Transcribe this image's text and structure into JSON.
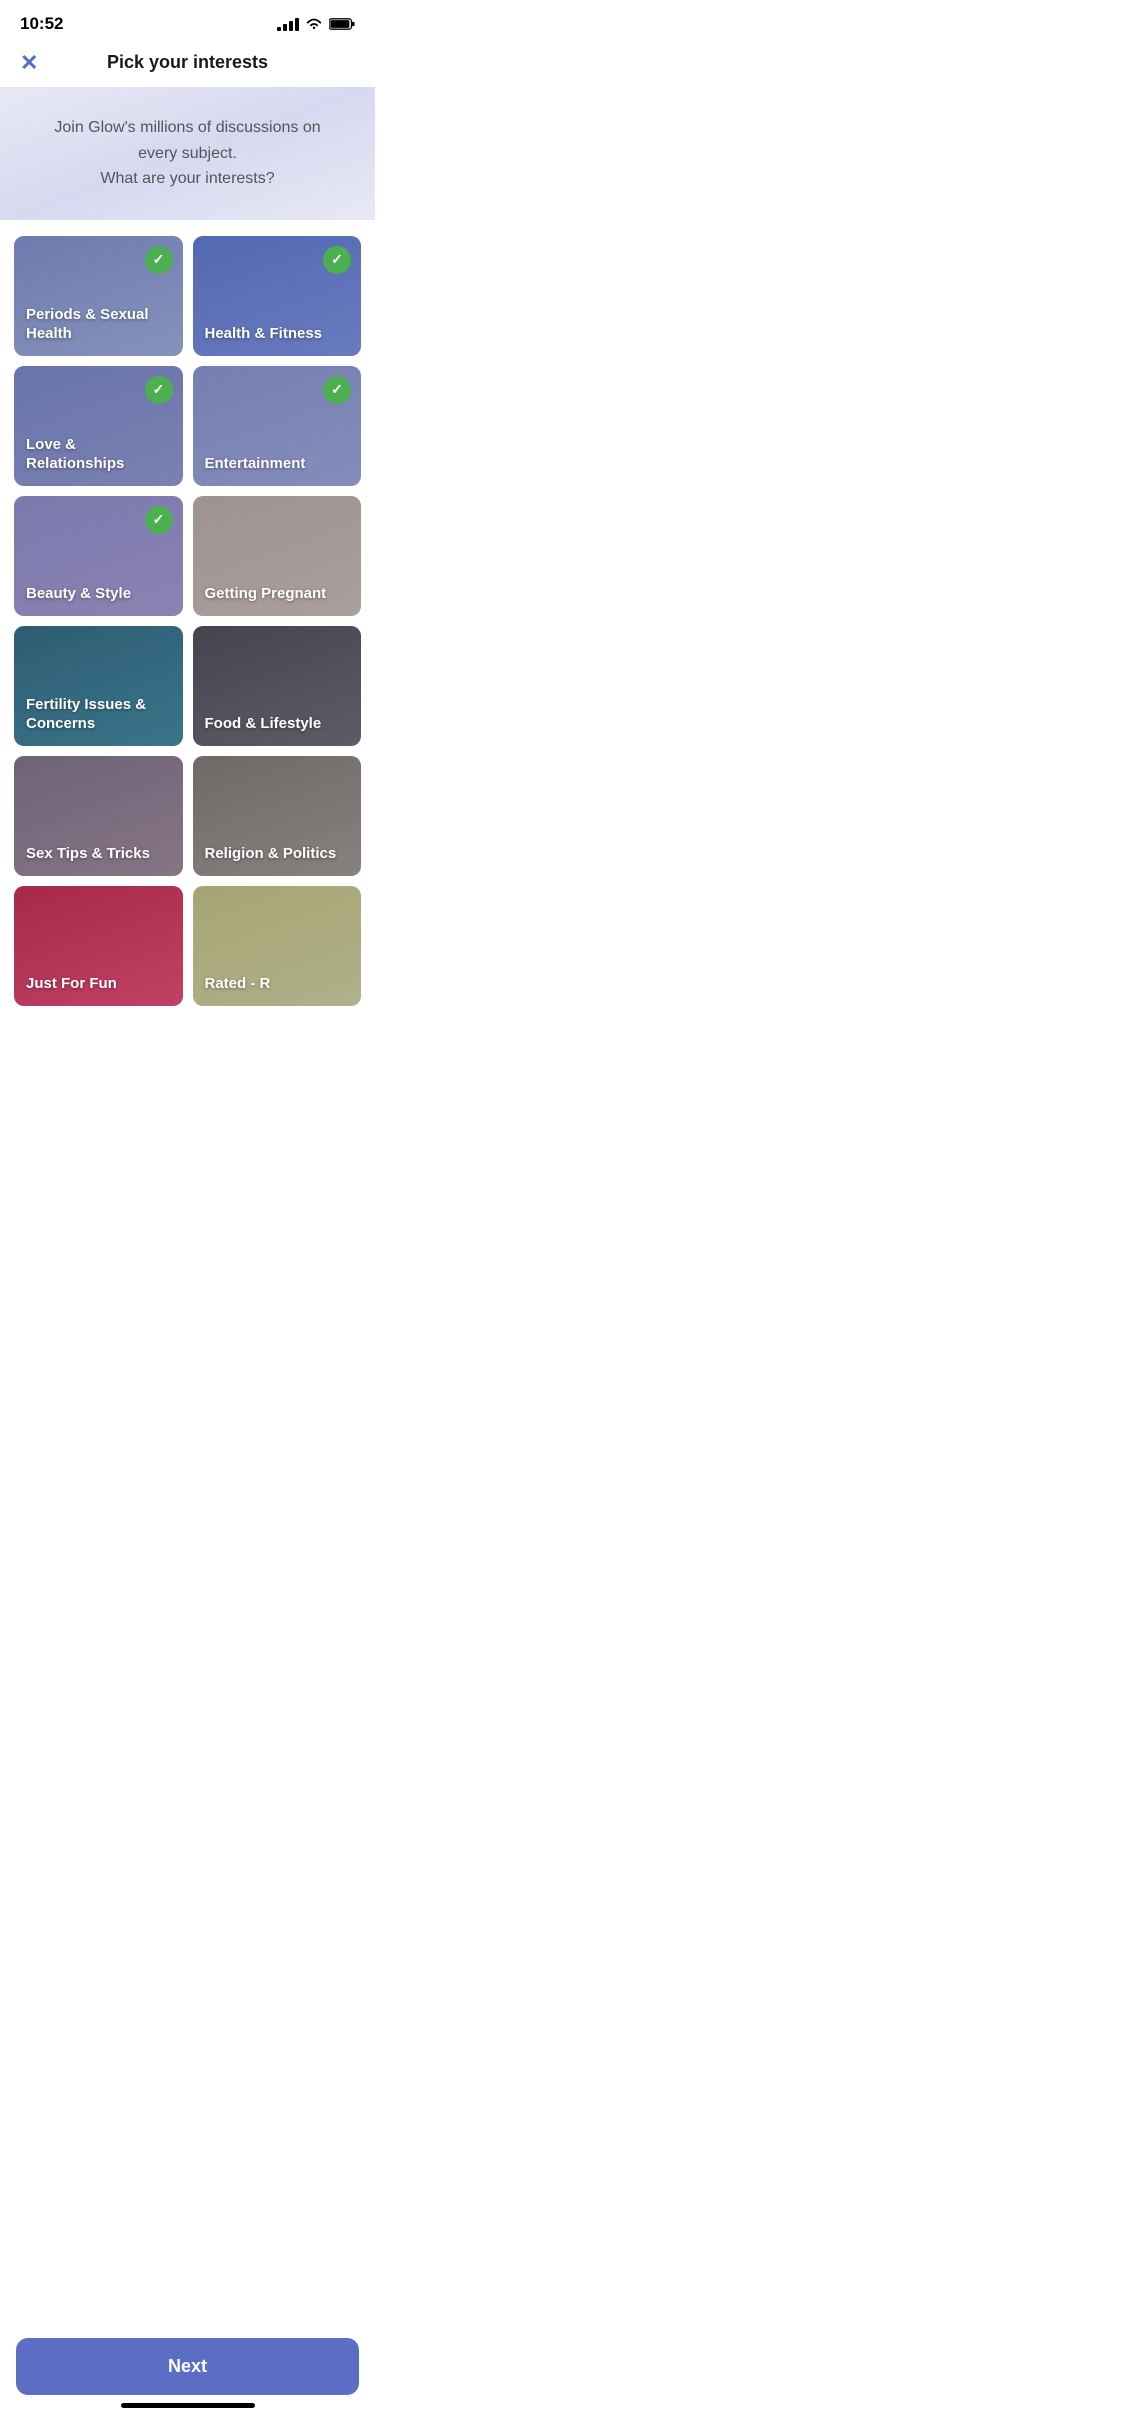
{
  "statusBar": {
    "time": "10:52"
  },
  "navBar": {
    "title": "Pick your interests",
    "closeIcon": "✕"
  },
  "header": {
    "text": "Join Glow's millions of discussions on every subject.\nWhat are your interests?"
  },
  "grid": {
    "items": [
      {
        "id": "periods",
        "label": "Periods & Sexual Health",
        "selected": true,
        "tileClass": "tile-periods"
      },
      {
        "id": "health",
        "label": "Health & Fitness",
        "selected": true,
        "tileClass": "tile-health"
      },
      {
        "id": "love",
        "label": "Love & Relationships",
        "selected": true,
        "tileClass": "tile-love"
      },
      {
        "id": "entertainment",
        "label": "Entertainment",
        "selected": true,
        "tileClass": "tile-entertainment"
      },
      {
        "id": "beauty",
        "label": "Beauty & Style",
        "selected": true,
        "tileClass": "tile-beauty"
      },
      {
        "id": "getting-pregnant",
        "label": "Getting Pregnant",
        "selected": false,
        "tileClass": "tile-getting-pregnant"
      },
      {
        "id": "fertility",
        "label": "Fertility Issues & Concerns",
        "selected": false,
        "tileClass": "tile-fertility"
      },
      {
        "id": "food",
        "label": "Food & Lifestyle",
        "selected": false,
        "tileClass": "tile-food"
      },
      {
        "id": "sex-tips",
        "label": "Sex Tips & Tricks",
        "selected": false,
        "tileClass": "tile-sex-tips"
      },
      {
        "id": "religion",
        "label": "Religion & Politics",
        "selected": false,
        "tileClass": "tile-religion"
      },
      {
        "id": "fun",
        "label": "Just For Fun",
        "selected": false,
        "tileClass": "tile-fun"
      },
      {
        "id": "rated-r",
        "label": "Rated - R",
        "selected": false,
        "tileClass": "tile-rated-r"
      }
    ]
  },
  "nextButton": {
    "label": "Next"
  }
}
